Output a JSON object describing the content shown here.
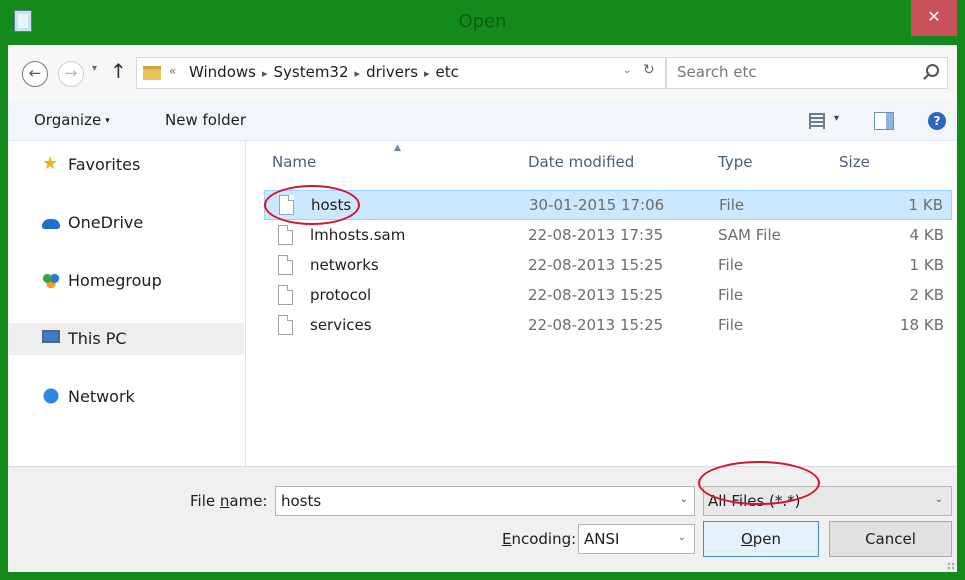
{
  "window": {
    "title": "Open",
    "close_glyph": "✕",
    "app_icon": "notepad-icon"
  },
  "nav": {
    "back_glyph": "←",
    "forward_glyph": "→",
    "recent_glyph": "▾",
    "up_glyph": "↑",
    "overflow_glyph": "«",
    "breadcrumbs": [
      "Windows",
      "System32",
      "drivers",
      "etc"
    ],
    "separator_glyph": "▸",
    "dropdown_glyph": "⌄",
    "refresh_glyph": "↻"
  },
  "search": {
    "placeholder": "Search etc"
  },
  "toolbar": {
    "organize_label": "Organize",
    "organize_caret": "▾",
    "new_folder_label": "New folder",
    "view_caret": "▾",
    "help_glyph": "?"
  },
  "sidebar": {
    "items": [
      {
        "label": "Favorites",
        "icon": "star-icon"
      },
      {
        "label": "OneDrive",
        "icon": "cloud-icon"
      },
      {
        "label": "Homegroup",
        "icon": "homegroup-icon"
      },
      {
        "label": "This PC",
        "icon": "computer-icon",
        "selected": true
      },
      {
        "label": "Network",
        "icon": "network-icon"
      }
    ]
  },
  "filelist": {
    "sort_glyph": "▲",
    "columns": {
      "name": "Name",
      "date": "Date modified",
      "type": "Type",
      "size": "Size"
    },
    "rows": [
      {
        "name": "hosts",
        "date": "30-01-2015 17:06",
        "type": "File",
        "size": "1 KB",
        "selected": true
      },
      {
        "name": "lmhosts.sam",
        "date": "22-08-2013 17:35",
        "type": "SAM File",
        "size": "4 KB"
      },
      {
        "name": "networks",
        "date": "22-08-2013 15:25",
        "type": "File",
        "size": "1 KB"
      },
      {
        "name": "protocol",
        "date": "22-08-2013 15:25",
        "type": "File",
        "size": "2 KB"
      },
      {
        "name": "services",
        "date": "22-08-2013 15:25",
        "type": "File",
        "size": "18 KB"
      }
    ]
  },
  "bottom": {
    "filename_label_pre": "File ",
    "filename_label_accel": "n",
    "filename_label_post": "ame:",
    "filename_value": "hosts",
    "filetype_value": "All Files  (*.*)",
    "encoding_label_pre": "",
    "encoding_label_accel": "E",
    "encoding_label_post": "ncoding:",
    "encoding_value": "ANSI",
    "open_label_accel": "O",
    "open_label_post": "pen",
    "cancel_label": "Cancel",
    "dropdown_glyph": "⌄"
  },
  "colors": {
    "titlebar": "#14891c",
    "close_button": "#c7505a",
    "selection": "#cce8ff",
    "annotation": "#d4152a"
  }
}
